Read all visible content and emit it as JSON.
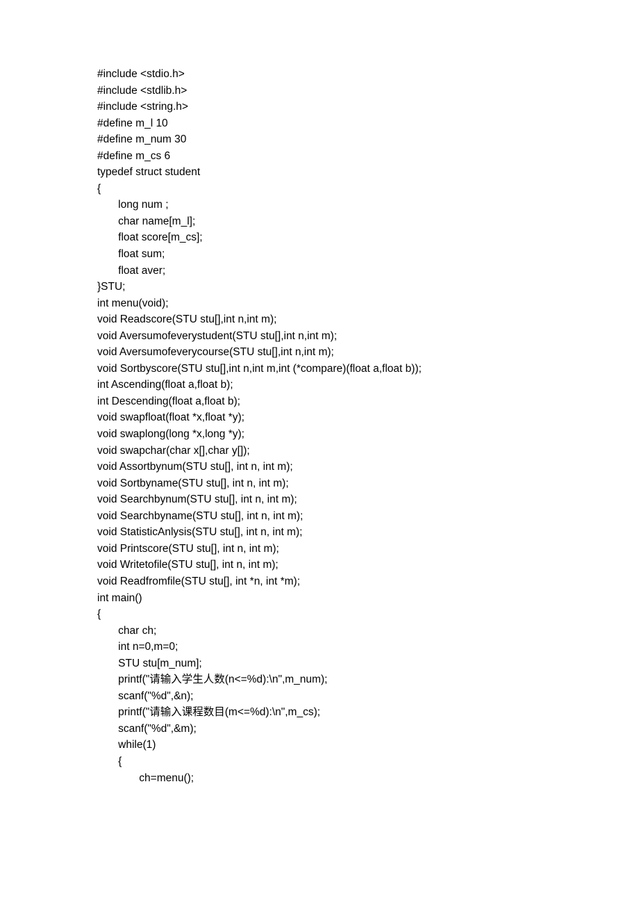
{
  "code_lines": [
    "#include <stdio.h>",
    "#include <stdlib.h>",
    "#include <string.h>",
    "#define m_l 10",
    "#define m_num 30",
    "#define m_cs 6",
    "typedef struct student",
    "{",
    "       long num ;",
    "       char name[m_l];",
    "       float score[m_cs];",
    "       float sum;",
    "       float aver;",
    "}STU;",
    "int menu(void);",
    "void Readscore(STU stu[],int n,int m);",
    "void Aversumofeverystudent(STU stu[],int n,int m);",
    "void Aversumofeverycourse(STU stu[],int n,int m);",
    "void Sortbyscore(STU stu[],int n,int m,int (*compare)(float a,float b));",
    "int Ascending(float a,float b);",
    "int Descending(float a,float b);",
    "void swapfloat(float *x,float *y);",
    "void swaplong(long *x,long *y);",
    "void swapchar(char x[],char y[]);",
    "void Assortbynum(STU stu[], int n, int m);",
    "void Sortbyname(STU stu[], int n, int m);",
    "void Searchbynum(STU stu[], int n, int m);",
    "void Searchbyname(STU stu[], int n, int m);",
    "void StatisticAnlysis(STU stu[], int n, int m);",
    "void Printscore(STU stu[], int n, int m);",
    "void Writetofile(STU stu[], int n, int m);",
    "void Readfromfile(STU stu[], int *n, int *m);",
    "int main()",
    "{",
    "       char ch;",
    "       int n=0,m=0;",
    "       STU stu[m_num];",
    "       printf(\"请输入学生人数(n<=%d):\\n\",m_num);",
    "       scanf(\"%d\",&n);",
    "       printf(\"请输入课程数目(m<=%d):\\n\",m_cs);",
    "       scanf(\"%d\",&m);",
    "       while(1)",
    "       {",
    "              ch=menu();"
  ]
}
